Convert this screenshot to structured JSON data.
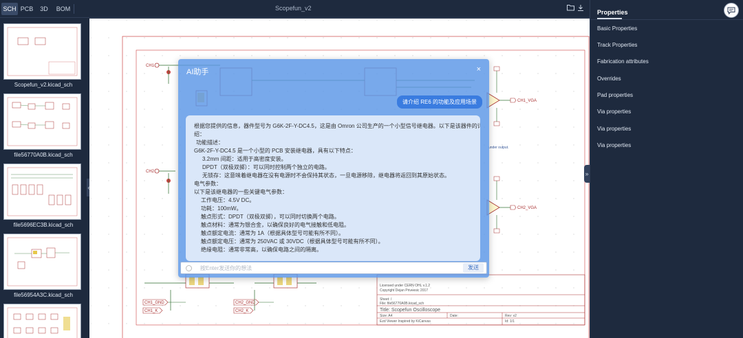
{
  "topbar": {
    "tabs": [
      {
        "label": "SCH",
        "active": true
      },
      {
        "label": "PCB",
        "active": false
      },
      {
        "label": "3D",
        "active": false
      },
      {
        "label": "BOM",
        "active": false
      }
    ],
    "document_title": "Scopefun_v2",
    "icons": [
      "folder-icon",
      "download-icon"
    ]
  },
  "sidebar": {
    "files": [
      {
        "label": "Scopefun_v2.kicad_sch"
      },
      {
        "label": "file56770A0B.kicad_sch"
      },
      {
        "label": "file5696EC3B.kicad_sch"
      },
      {
        "label": "file56954A3C.kicad_sch"
      }
    ]
  },
  "properties": {
    "title": "Properties",
    "items": [
      "Basic Properties",
      "Track Properties",
      "Fabrication attributes",
      "Overrides",
      "Pad properties",
      "Via properties",
      "Via properties",
      "Via properties"
    ]
  },
  "schematic": {
    "labels": {
      "ch1": "CH1",
      "ch2": "CH2",
      "ch1_vga": "CH1_VGA",
      "ch2_vga": "CH2_VGA",
      "ch1_gnd": "CH1_GND",
      "ch1_k": "CH1_K",
      "ch2_gnd": "CH2_GND",
      "ch2_k": "CH2_K",
      "under_output": "under output."
    },
    "title_block": {
      "license": "Licensed under CERN OHL v.1.2",
      "copyright": "Copyright Dejan Priveesic 2017",
      "sheet": "Sheet: /",
      "file": "File: file56770A0B.kicad_sch",
      "title": "Title: Scopefun Oscilloscope",
      "size": "Size: A4",
      "date": "Date:",
      "rev": "Rev: v2",
      "tool": "Ezd Viewer Inspired by KiCanvas",
      "id": "Id: 1/1"
    }
  },
  "ai_dialog": {
    "title": "AI助手",
    "question": "请介绍 RE6 的功能及应用场景",
    "answer_lines": [
      {
        "text": "根据您提供的信息，器件型号为 G6K-2F-Y-DC4.5，这是由 Omron 公司生产的一个小型信号继电器。以下是该器件的详细介",
        "indent": 0
      },
      {
        "text": "绍：",
        "indent": 0
      },
      {
        "text": "功能描述：",
        "indent": 0
      },
      {
        "text": "G6K-2F-Y-DC4.5 是一个小型的 PCB 安装继电器，具有以下特点：",
        "indent": 0
      },
      {
        "text": "3.2mm 间距：适用于高密度安装。",
        "indent": 1
      },
      {
        "text": "DPDT（双极双掷）：可以同时控制两个独立的电路。",
        "indent": 1
      },
      {
        "text": "无锁存：这意味着继电器在没有电源时不会保持其状态，一旦电源移除，继电器将返回到其原始状态。",
        "indent": 1
      },
      {
        "text": "电气参数：",
        "indent": 0
      },
      {
        "text": "以下是该继电器的一些关键电气参数：",
        "indent": 0
      },
      {
        "text": "工作电压：4.5V DC。",
        "indent": 2
      },
      {
        "text": "功耗：100mW。",
        "indent": 2
      },
      {
        "text": "触点形式：DPDT（双极双掷），可以同时切换两个电路。",
        "indent": 2
      },
      {
        "text": "触点材料：通常为银合金，以确保良好的电气接触和低电阻。",
        "indent": 2
      },
      {
        "text": "触点额定电流：通常为 1A（根据具体型号可能有所不同）。",
        "indent": 2
      },
      {
        "text": "触点额定电压：通常为 250VAC 或 30VDC（根据具体型号可能有所不同）。",
        "indent": 2
      },
      {
        "text": "绝缘电阻：通常非常高，以确保电路之间的隔离。",
        "indent": 2
      }
    ],
    "input_placeholder": "按Enter发送你的想法",
    "send_label": "发送",
    "close_label": "×"
  }
}
